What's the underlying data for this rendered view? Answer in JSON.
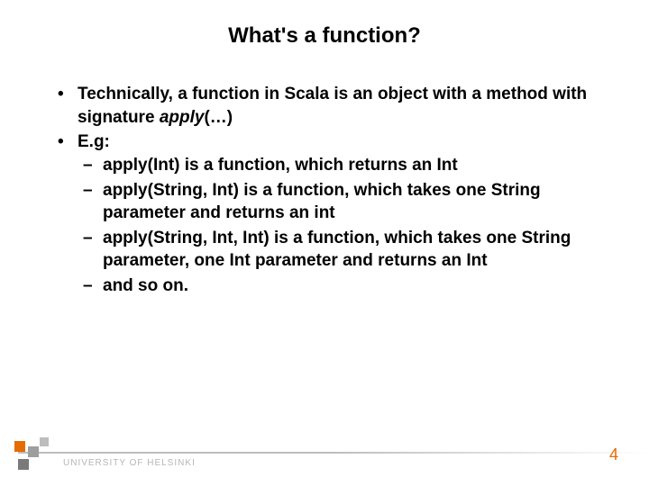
{
  "title": "What's a function?",
  "bullets": [
    {
      "runs": [
        {
          "text": "Technically, a function in Scala is an object with a method with signature ",
          "italic": false
        },
        {
          "text": "apply",
          "italic": true
        },
        {
          "text": "(…)",
          "italic": false
        }
      ]
    },
    {
      "runs": [
        {
          "text": "E.g:",
          "italic": false
        }
      ],
      "children": [
        {
          "runs": [
            {
              "text": "apply(Int) is a function, which returns an Int",
              "italic": false
            }
          ]
        },
        {
          "runs": [
            {
              "text": "apply(String, Int) is a function, which takes one String parameter and returns an int",
              "italic": false
            }
          ]
        },
        {
          "runs": [
            {
              "text": "apply(String, Int, Int) is a function, which takes one String parameter, one Int parameter and returns an Int",
              "italic": false
            }
          ]
        },
        {
          "runs": [
            {
              "text": "and so on.",
              "italic": false
            }
          ]
        }
      ]
    }
  ],
  "footer": {
    "university": "UNIVERSITY OF HELSINKI",
    "page_number": "4"
  },
  "colors": {
    "accent": "#e56a00",
    "footer_text": "#b6b6b6"
  }
}
